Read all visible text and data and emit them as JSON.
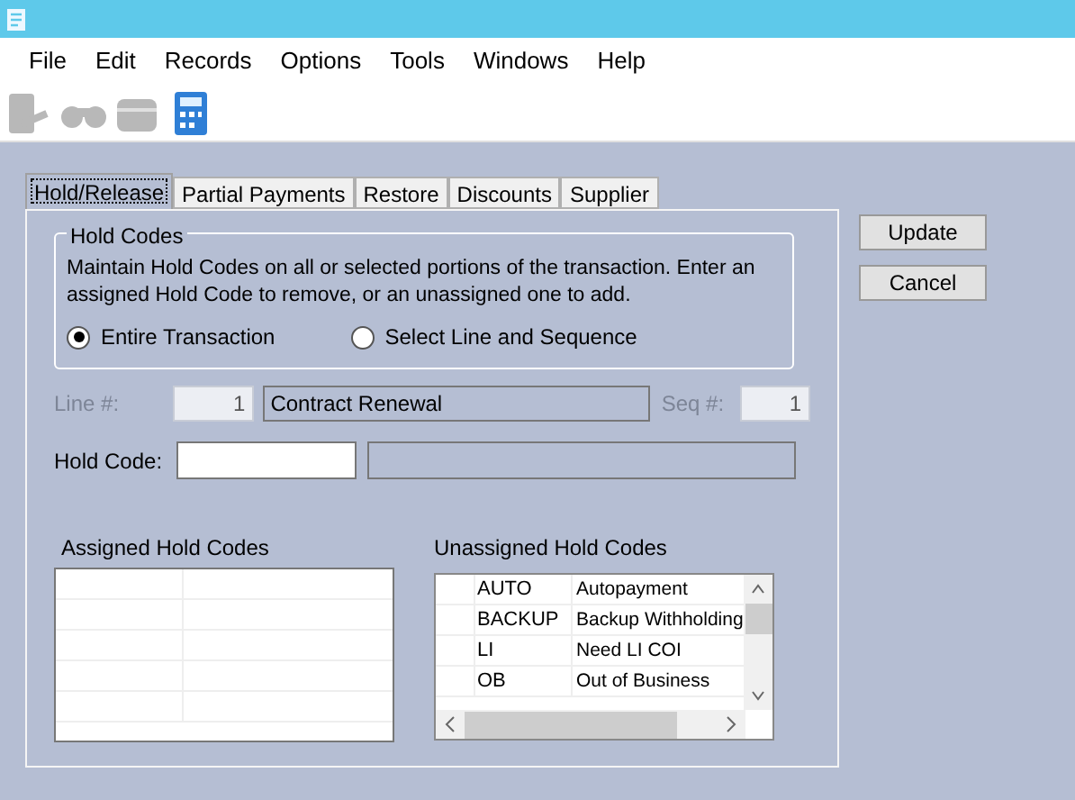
{
  "menu": [
    "File",
    "Edit",
    "Records",
    "Options",
    "Tools",
    "Windows",
    "Help"
  ],
  "toolbar": [
    {
      "kind": "tablet",
      "disabled": true
    },
    {
      "kind": "binoculars",
      "disabled": true
    },
    {
      "kind": "box",
      "disabled": true
    },
    {
      "kind": "calculator",
      "disabled": false
    }
  ],
  "tabs": [
    {
      "label": "Hold/Release",
      "selected": true
    },
    {
      "label": "Partial Payments",
      "selected": false
    },
    {
      "label": "Restore",
      "selected": false
    },
    {
      "label": "Discounts",
      "selected": false
    },
    {
      "label": "Supplier",
      "selected": false
    }
  ],
  "hold_codes": {
    "title": "Hold Codes",
    "description": "Maintain Hold Codes on all or selected portions of the transaction.  Enter an assigned Hold Code to remove, or an unassigned one to add.",
    "options": [
      {
        "label": "Entire Transaction",
        "selected": true
      },
      {
        "label": "Select Line and Sequence",
        "selected": false
      }
    ]
  },
  "line": {
    "label": "Line #:",
    "value": "1",
    "description": "Contract Renewal",
    "disabled": true
  },
  "seq": {
    "label": "Seq #:",
    "value": "1",
    "disabled": true
  },
  "hold_code": {
    "label": "Hold Code:"
  },
  "assigned": {
    "title": "Assigned Hold Codes"
  },
  "unassigned": {
    "title": "Unassigned Hold Codes",
    "rows": [
      {
        "code": "AUTO",
        "name": "Autopayment"
      },
      {
        "code": "BACKUP",
        "name": "Backup Withholding"
      },
      {
        "code": "LI",
        "name": "Need LI COI"
      },
      {
        "code": "OB",
        "name": "Out of Business"
      }
    ]
  },
  "buttons": [
    "Update",
    "Cancel"
  ]
}
